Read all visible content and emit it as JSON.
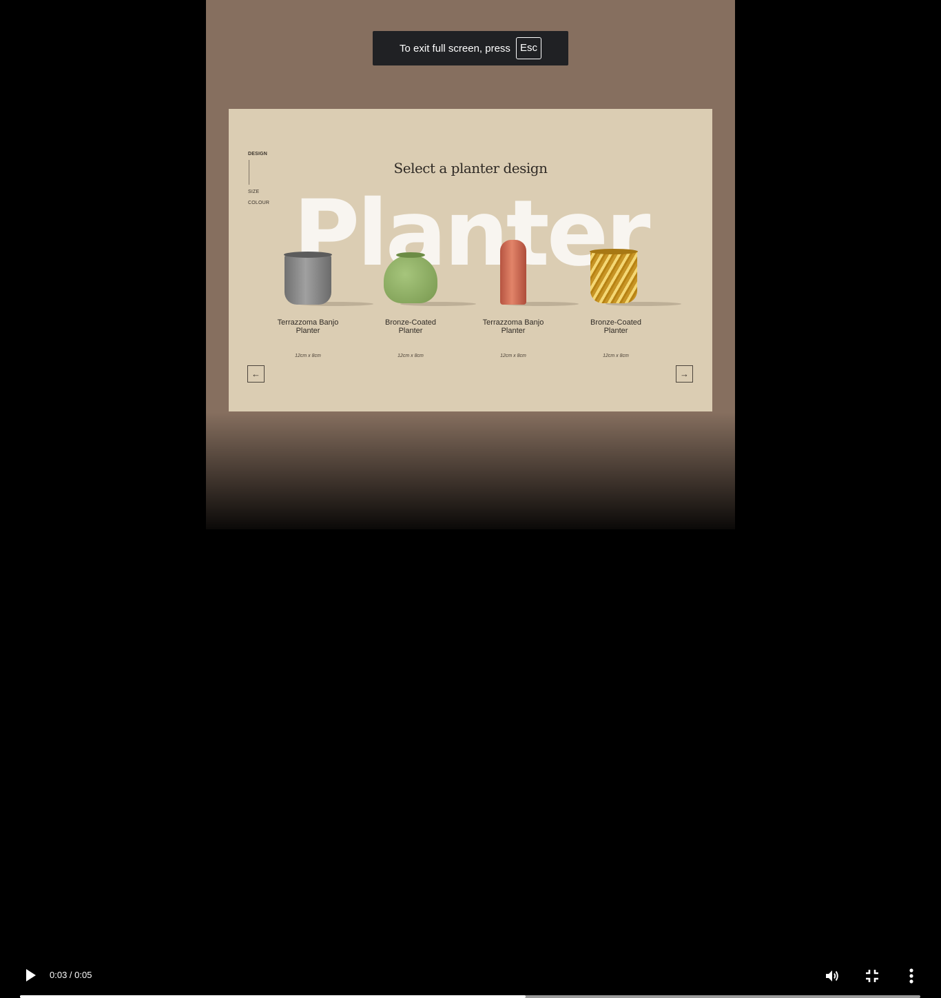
{
  "notice": {
    "text": "To exit full screen, press",
    "key": "Esc"
  },
  "slide": {
    "steps": [
      "DESIGN",
      "SIZE",
      "COLOUR"
    ],
    "title": "Select a planter design",
    "background_word": "Planter",
    "products": [
      {
        "name_line1": "Terrazzoma Banjo",
        "name_line2": "Planter",
        "size": "12cm x 8cm",
        "color": "#8f8f8f"
      },
      {
        "name_line1": "Bronze-Coated",
        "name_line2": "Planter",
        "size": "12cm x 8cm",
        "color": "#8fb064"
      },
      {
        "name_line1": "Terrazzoma Banjo",
        "name_line2": "Planter",
        "size": "12cm x 8cm",
        "color": "#d36e55"
      },
      {
        "name_line1": "Bronze-Coated",
        "name_line2": "Planter",
        "size": "12cm x 8cm",
        "color": "#d8b241"
      }
    ],
    "prev_icon": "arrow-left-icon",
    "next_icon": "arrow-right-icon",
    "background_color": "#dbcdb3"
  },
  "video": {
    "time": "0:03 / 0:05",
    "progress": 0.5615,
    "frame_color": "#866f5f",
    "icons": {
      "play": "play-icon",
      "volume": "volume-icon",
      "exit_fullscreen": "exit-fullscreen-icon",
      "more": "more-vert-icon"
    }
  }
}
